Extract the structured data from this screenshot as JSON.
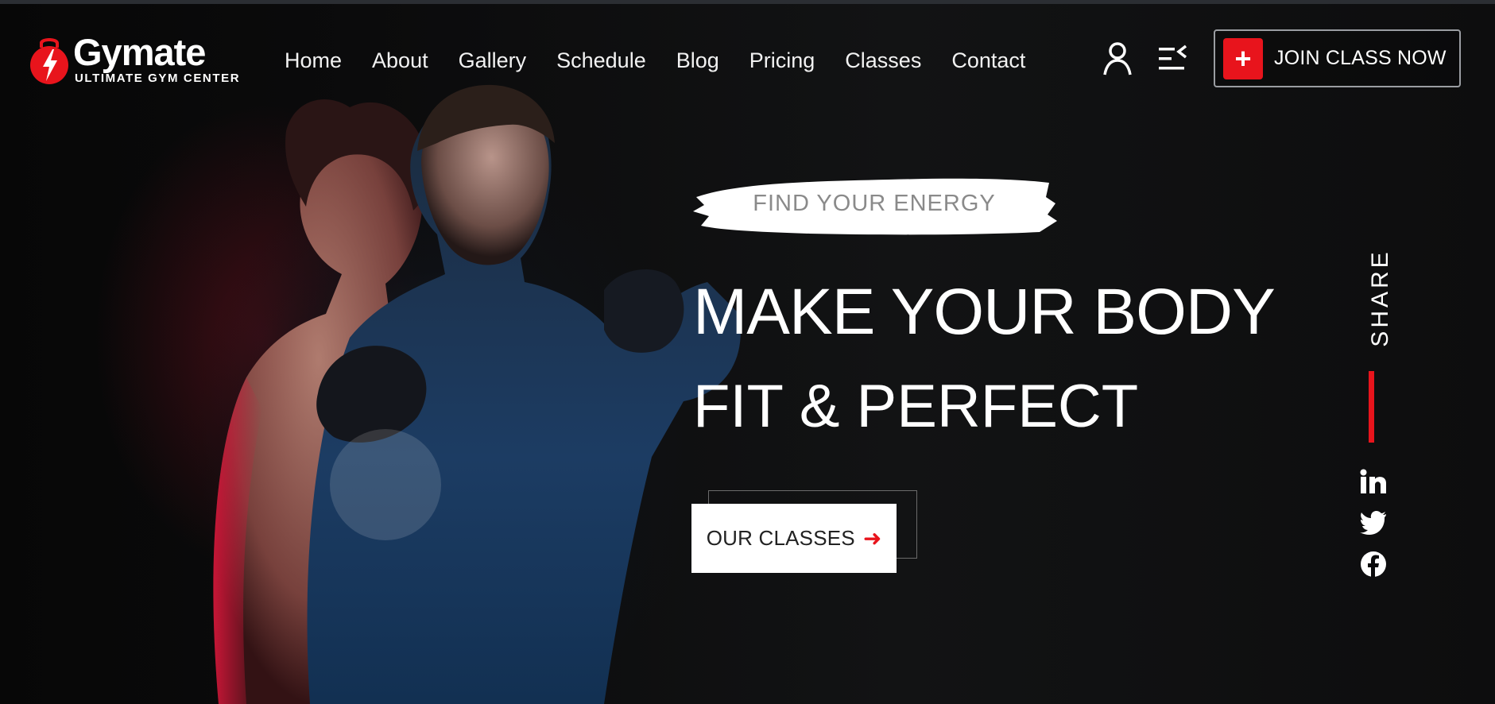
{
  "brand": {
    "name": "Gymate",
    "tagline": "ULTIMATE GYM CENTER"
  },
  "nav": {
    "items": [
      "Home",
      "About",
      "Gallery",
      "Schedule",
      "Blog",
      "Pricing",
      "Classes",
      "Contact"
    ]
  },
  "header": {
    "join_label": "JOIN CLASS NOW",
    "join_icon": "plus-icon",
    "user_icon": "user-icon",
    "menu_icon": "menu-icon"
  },
  "hero": {
    "tagline": "FIND YOUR ENERGY",
    "headline": "MAKE YOUR BODY",
    "subline": "FIT & PERFECT",
    "cta_label": "OUR CLASSES",
    "cta_icon": "arrow-right-icon"
  },
  "share": {
    "label": "SHARE",
    "icons": [
      "linkedin-icon",
      "twitter-icon",
      "facebook-icon"
    ]
  },
  "colors": {
    "accent": "#e8141c",
    "background": "#0b0b0c",
    "text": "#ffffff"
  }
}
